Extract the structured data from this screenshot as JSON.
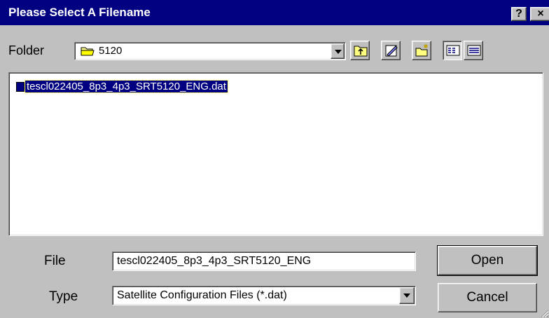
{
  "window": {
    "title": "Please Select A Filename",
    "help_label": "?",
    "close_label": "×"
  },
  "folder": {
    "label": "Folder",
    "value": "5120"
  },
  "toolbar": {
    "buttons": [
      "up-one-level",
      "edit-properties",
      "create-new-folder",
      "list-view",
      "details-view"
    ]
  },
  "file_list": {
    "items": [
      {
        "name": "tescl022405_8p3_4p3_SRT5120_ENG.dat",
        "selected": true
      }
    ]
  },
  "file_field": {
    "label": "File",
    "value": "tescl022405_8p3_4p3_SRT5120_ENG"
  },
  "type_field": {
    "label": "Type",
    "value": "Satellite Configuration Files (*.dat)"
  },
  "buttons": {
    "open_label": "Open",
    "cancel_label": "Cancel"
  },
  "colors": {
    "titlebar": "#000080",
    "face": "#c0c0c0",
    "selection": "#000080"
  }
}
